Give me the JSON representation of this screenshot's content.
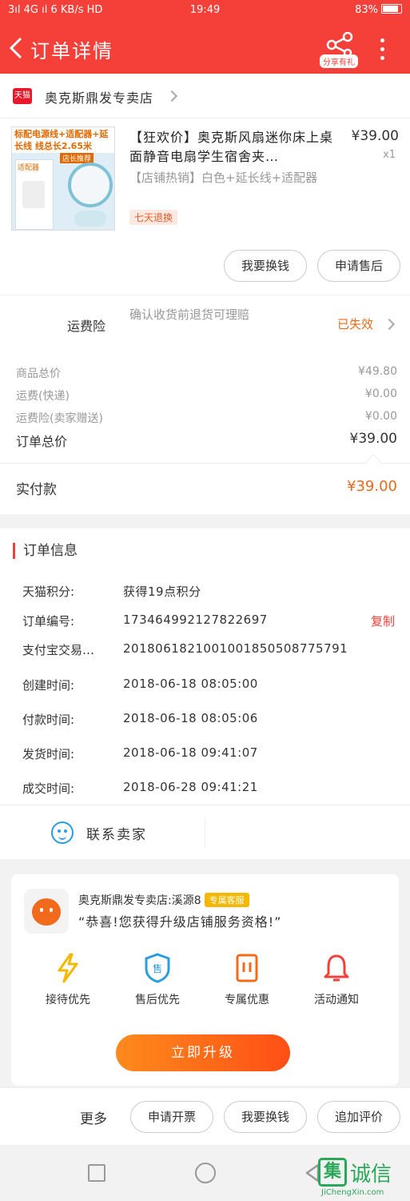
{
  "status_bar": {
    "signal": "3ıl 4G ıl",
    "speed": "6 KB/s",
    "hd": "HD",
    "time": "19:49",
    "battery": "83%"
  },
  "nav": {
    "title": "订单详情",
    "share_tag": "分享有礼"
  },
  "shop": {
    "name": "奥克斯鼎发专卖店",
    "tmall_badge": "天猫"
  },
  "product": {
    "image_text": "标配电源线+适配器+延长线 线总长2.65米",
    "image_badge1": "适配器",
    "image_badge2": "店长推荐",
    "name": "【狂欢价】奥克斯风扇迷你床上桌面静音电扇学生宿舍夹…",
    "sku": "【店铺热销】白色+延长线+适配器",
    "tag": "七天退换",
    "price": "¥39.00",
    "qty": "x1"
  },
  "product_actions": {
    "refund": "我要换钱",
    "after_sale": "申请售后"
  },
  "insurance": {
    "label": "运费险",
    "desc": "确认收货前退货可理赔",
    "status": "已失效"
  },
  "fees": [
    {
      "label": "商品总价",
      "value": "¥49.80"
    },
    {
      "label": "运费(快递)",
      "value": "¥0.00"
    },
    {
      "label": "运费险(卖家赠送)",
      "value": "¥0.00"
    }
  ],
  "total": {
    "label": "订单总价",
    "value": "¥39.00"
  },
  "paid": {
    "label": "实付款",
    "value": "¥39.00"
  },
  "order_info": {
    "title": "订单信息",
    "copy": "复制",
    "rows": [
      {
        "key": "天猫积分:",
        "value": "获得19点积分"
      },
      {
        "key": "订单编号:",
        "value": "173464992127822697"
      },
      {
        "key": "支付宝交易…",
        "value": "2018061821001001850508775791"
      },
      {
        "key": "创建时间:",
        "value": "2018-06-18 08:05:00"
      },
      {
        "key": "付款时间:",
        "value": "2018-06-18 08:05:06"
      },
      {
        "key": "发货时间:",
        "value": "2018-06-18 09:41:07"
      },
      {
        "key": "成交时间:",
        "value": "2018-06-28 09:41:21"
      }
    ]
  },
  "contact": {
    "label": "联系卖家"
  },
  "promo": {
    "shop_line": "奥克斯鼎发专卖店:溪源8",
    "badge": "专属客服",
    "message": "“恭喜!您获得升级店铺服务资格!”",
    "features": [
      {
        "label": "接待优先",
        "icon": "lightning-icon",
        "color": "#f5b800"
      },
      {
        "label": "售后优先",
        "icon": "shield-icon",
        "color": "#2a9de0"
      },
      {
        "label": "专属优惠",
        "icon": "coupon-icon",
        "color": "#f26a1b"
      },
      {
        "label": "活动通知",
        "icon": "bell-icon",
        "color": "#f5403a"
      }
    ],
    "upgrade": "立即升级"
  },
  "bottom_actions": {
    "more": "更多",
    "invoice": "申请开票",
    "refund": "我要换钱",
    "review": "追加评价"
  },
  "watermark": {
    "mark": "集",
    "name": "诚信",
    "url": "JiChengXin.com"
  }
}
